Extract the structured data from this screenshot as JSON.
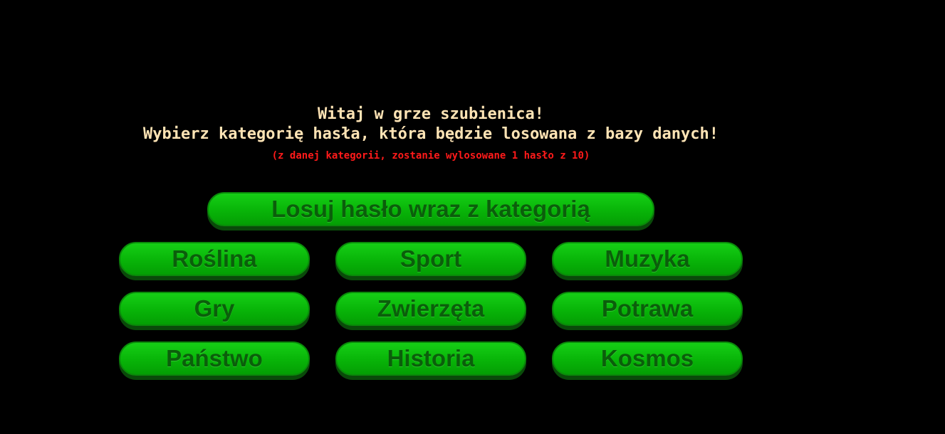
{
  "header": {
    "welcome": "Witaj w grze szubienica!",
    "instruction": "Wybierz kategorię hasła, która będzie losowana z bazy danych!",
    "note": "(z danej kategorii, zostanie wylosowane 1 hasło z 10)"
  },
  "random_button_label": "Losuj hasło wraz z kategorią",
  "categories": [
    "Roślina",
    "Sport",
    "Muzyka",
    "Gry",
    "Zwierzęta",
    "Potrawa",
    "Państwo",
    "Historia",
    "Kosmos"
  ],
  "colors": {
    "background": "#000000",
    "heading_text": "#ffe4b5",
    "note_text": "#ff1a1a",
    "button_green": "#08b408",
    "button_text": "#0b5e0b"
  }
}
